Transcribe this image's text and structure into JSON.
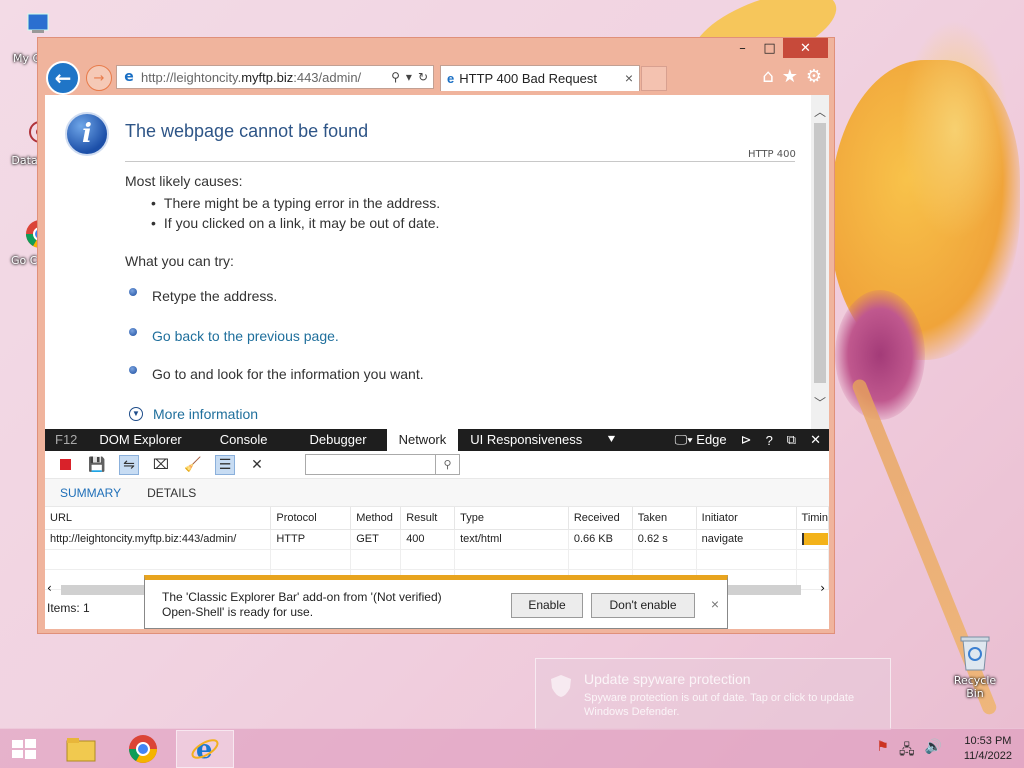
{
  "desktop": {
    "icons": [
      {
        "label": "My Co"
      },
      {
        "label": "DataW"
      },
      {
        "label": "Go Chr"
      },
      {
        "label": "Recycle Bin"
      }
    ]
  },
  "browser": {
    "address": {
      "prefix": "http://leightoncity.",
      "host": "myftp.biz",
      "suffix": ":443/admin/"
    },
    "tab": {
      "title": "HTTP 400 Bad Request",
      "close": "×"
    },
    "window_controls": {
      "minimize": "–",
      "maximize": "□",
      "close": "✕"
    }
  },
  "page": {
    "title": "The webpage cannot be found",
    "code": "HTTP 400",
    "causes_heading": "Most likely causes:",
    "causes": [
      "There might be a typing error in the address.",
      "If you clicked on a link, it may be out of date."
    ],
    "try_heading": "What you can try:",
    "try_items": [
      {
        "label": "Retype the address."
      },
      {
        "label": "Go back to the previous page."
      },
      {
        "label": "Go to  and look for the information you want."
      }
    ],
    "more_info": "More information"
  },
  "devtools": {
    "tabs": [
      "F12",
      "DOM Explorer",
      "Console",
      "Debugger",
      "Network",
      "UI Responsiveness"
    ],
    "active_tab": "Network",
    "mode": "Edge",
    "subtabs": [
      "SUMMARY",
      "DETAILS"
    ],
    "columns": [
      "URL",
      "Protocol",
      "Method",
      "Result",
      "Type",
      "Received",
      "Taken",
      "Initiator",
      "Timin"
    ],
    "rows": [
      {
        "url": "http://leightoncity.myftp.biz:443/admin/",
        "protocol": "HTTP",
        "method": "GET",
        "result": "400",
        "type": "text/html",
        "received": "0.66 KB",
        "taken": "0.62 s",
        "initiator": "navigate"
      }
    ],
    "items_count": "Items: 1"
  },
  "notification": {
    "line1": "The 'Classic Explorer Bar' add-on from '(Not verified)",
    "line2": "Open-Shell' is ready for use.",
    "enable": "Enable",
    "dont_enable": "Don't enable",
    "close": "×"
  },
  "toast": {
    "title": "Update spyware protection",
    "body": "Spyware protection is out of date. Tap or click to update Windows Defender."
  },
  "taskbar": {
    "time": "10:53 PM",
    "date": "11/4/2022"
  },
  "colors": {
    "window_frame": "#f0b49d",
    "link": "#1f6f9c",
    "title": "#2e5587",
    "notif_accent": "#e8a41e"
  }
}
